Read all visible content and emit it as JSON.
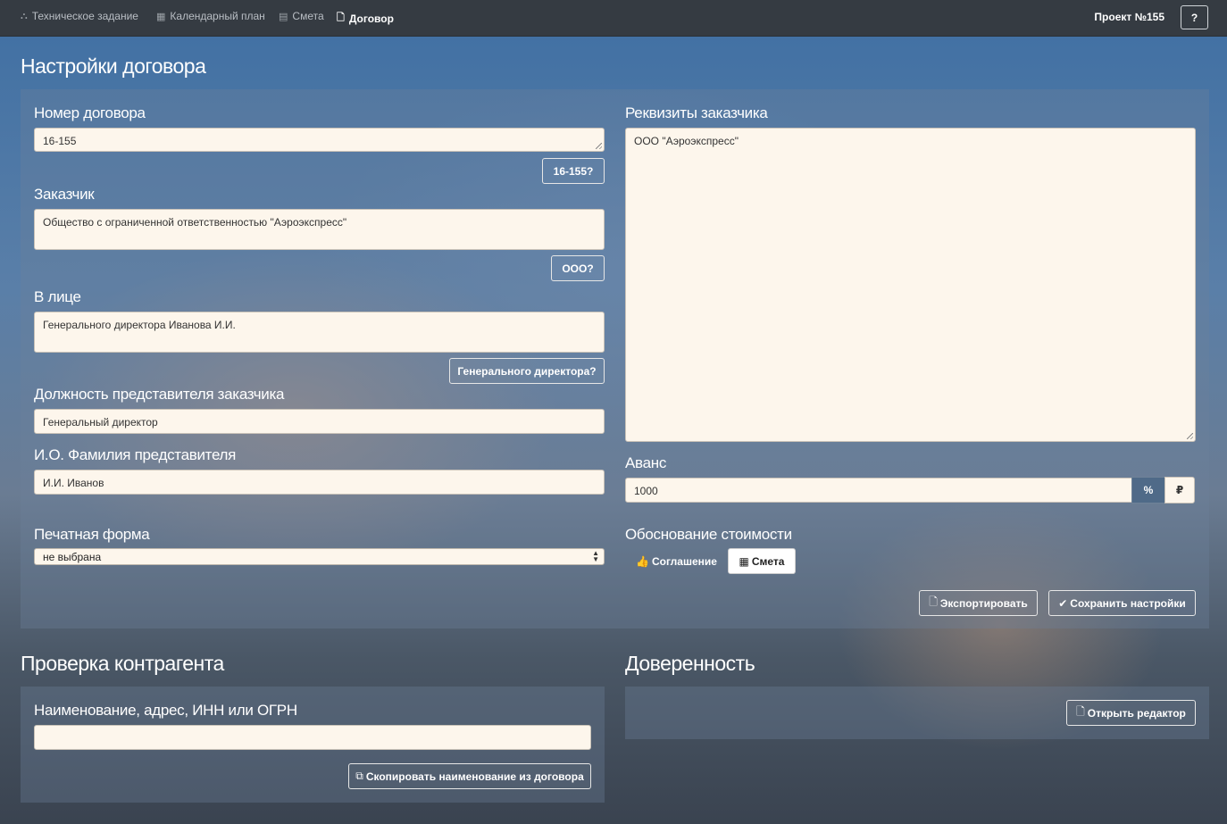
{
  "nav": {
    "items": [
      {
        "icon": "sitemap-icon",
        "glyph": "⛬",
        "label": "Техническое задание"
      },
      {
        "icon": "calendar-icon",
        "glyph": "▦",
        "label": "Календарный план"
      },
      {
        "icon": "table-icon",
        "glyph": "▤",
        "label": "Смета"
      },
      {
        "icon": "file-icon",
        "glyph": "🗋",
        "label": "Договор"
      }
    ],
    "project": "Проект №155",
    "help": "?"
  },
  "contract": {
    "title": "Настройки договора",
    "number_label": "Номер договора",
    "number_value": "16-155",
    "number_suggest": "16-155?",
    "customer_label": "Заказчик",
    "customer_value": "Общество с ограниченной ответственностью \"Аэроэкспресс\"",
    "customer_suggest": "ООО?",
    "person_label": "В лице",
    "person_value": "Генерального директора Иванова И.И.",
    "person_suggest": "Генерального директора?",
    "position_label": "Должность представителя заказчика",
    "position_value": "Генеральный директор",
    "rep_name_label": "И.О. Фамилия представителя",
    "rep_name_value": "И.И. Иванов",
    "print_form_label": "Печатная форма",
    "print_form_value": "не выбрана",
    "requisites_label": "Реквизиты заказчика",
    "requisites_value": "ООО \"Аэроэкспресс\"",
    "advance_label": "Аванс",
    "advance_value": "1000",
    "advance_percent": "%",
    "advance_rub": "₽",
    "justification_label": "Обоснование стоимости",
    "justification_agreement": "Соглашение",
    "justification_estimate": "Смета",
    "export": "Экспортировать",
    "save": "Сохранить настройки"
  },
  "counterparty": {
    "title": "Проверка контрагента",
    "search_label": "Наименование, адрес, ИНН или ОГРН",
    "search_value": "",
    "copy_button": "Скопировать наименование из договора"
  },
  "power_of_attorney": {
    "title": "Доверенность",
    "open_editor": "Открыть редактор"
  }
}
